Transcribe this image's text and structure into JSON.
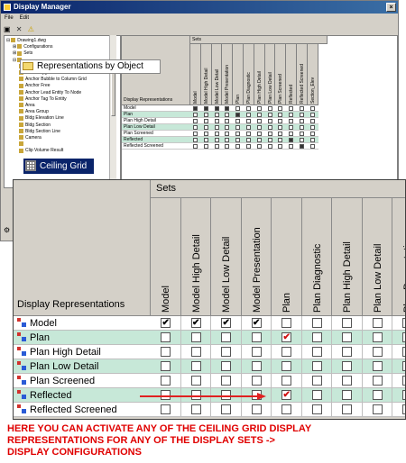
{
  "window": {
    "title": "Display Manager",
    "close_glyph": "×",
    "menu": [
      "File",
      "Edit"
    ],
    "toolbar_icons": [
      "save-icon",
      "delete-icon",
      "warning-icon"
    ],
    "toolbar_glyphs": [
      "▣",
      "✕",
      "⚠"
    ]
  },
  "tree": {
    "items": [
      {
        "label": "Drawing1.dwg",
        "indent": 0,
        "expander": "⊟"
      },
      {
        "label": "Configurations",
        "indent": 1,
        "expander": "⊞"
      },
      {
        "label": "Sets",
        "indent": 1,
        "expander": "⊞"
      },
      {
        "label": "",
        "indent": 1,
        "expander": "⊟"
      },
      {
        "label": "AEC Dimension",
        "indent": 2,
        "expander": ""
      },
      {
        "label": "AEC Polygon",
        "indent": 2,
        "expander": ""
      },
      {
        "label": "Anchor Bubble to Column Grid",
        "indent": 2,
        "expander": ""
      },
      {
        "label": "Anchor Free",
        "indent": 2,
        "expander": ""
      },
      {
        "label": "Anchor Lead Entity To Node",
        "indent": 2,
        "expander": ""
      },
      {
        "label": "Anchor Tag To Entity",
        "indent": 2,
        "expander": ""
      },
      {
        "label": "Area",
        "indent": 2,
        "expander": ""
      },
      {
        "label": "Area Group",
        "indent": 2,
        "expander": ""
      },
      {
        "label": "Bldg Elevation Line",
        "indent": 2,
        "expander": ""
      },
      {
        "label": "Bldg Section",
        "indent": 2,
        "expander": ""
      },
      {
        "label": "Bldg Section Line",
        "indent": 2,
        "expander": ""
      },
      {
        "label": "Camera",
        "indent": 2,
        "expander": ""
      },
      {
        "label": "",
        "indent": 2,
        "expander": ""
      },
      {
        "label": "Clip Volume Result",
        "indent": 2,
        "expander": ""
      }
    ],
    "callout_representations": "Representations by Object",
    "callout_ceiling": "Ceiling Grid"
  },
  "small_grid": {
    "sets_label": "Sets",
    "display_representations_label": "Display Representations",
    "columns": [
      "Model",
      "Model High Detail",
      "Model Low Detail",
      "Model Presentation",
      "Plan",
      "Plan Diagnostic",
      "Plan High Detail",
      "Plan Low Detail",
      "Plan Screened",
      "Reflected",
      "Reflected Screened",
      "Section_Elev"
    ],
    "rows": [
      "Model",
      "Plan",
      "Plan High Detail",
      "Plan Low Detail",
      "Plan Screened",
      "Reflected",
      "Reflected Screened"
    ],
    "checked": [
      [
        true,
        true,
        true,
        true,
        false,
        false,
        false,
        false,
        false,
        false,
        false,
        false
      ],
      [
        false,
        false,
        false,
        false,
        true,
        false,
        false,
        false,
        false,
        false,
        false,
        false
      ],
      [
        false,
        false,
        false,
        false,
        false,
        false,
        false,
        false,
        false,
        false,
        false,
        false
      ],
      [
        false,
        false,
        false,
        false,
        false,
        false,
        false,
        false,
        false,
        false,
        false,
        false
      ],
      [
        false,
        false,
        false,
        false,
        false,
        false,
        false,
        false,
        false,
        false,
        false,
        false
      ],
      [
        false,
        false,
        false,
        false,
        false,
        false,
        false,
        false,
        false,
        true,
        false,
        false
      ],
      [
        false,
        false,
        false,
        false,
        false,
        false,
        false,
        false,
        false,
        false,
        true,
        false
      ]
    ]
  },
  "zoom_grid": {
    "sets_label": "Sets",
    "display_representations_label": "Display Representations",
    "columns": [
      "Model",
      "Model High Detail",
      "Model Low Detail",
      "Model Presentation",
      "Plan",
      "Plan Diagnostic",
      "Plan High Detail",
      "Plan Low Detail",
      "Plan Presentation"
    ],
    "rows": [
      "Model",
      "Plan",
      "Plan High Detail",
      "Plan Low Detail",
      "Plan Screened",
      "Reflected",
      "Reflected Screened"
    ],
    "checked": [
      [
        "black",
        "black",
        "black",
        "black",
        "",
        "",
        "",
        "",
        ""
      ],
      [
        "",
        "",
        "",
        "",
        "red",
        "",
        "",
        "",
        ""
      ],
      [
        "",
        "",
        "",
        "",
        "",
        "",
        "",
        "",
        ""
      ],
      [
        "",
        "",
        "",
        "",
        "",
        "",
        "",
        "",
        ""
      ],
      [
        "",
        "",
        "",
        "",
        "",
        "",
        "",
        "",
        ""
      ],
      [
        "",
        "",
        "",
        "",
        "red",
        "",
        "",
        "",
        ""
      ],
      [
        "",
        "",
        "",
        "",
        "",
        "",
        "",
        "",
        ""
      ]
    ],
    "check_glyph": "✔"
  },
  "caption": {
    "lines": [
      "HERE YOU CAN ACTIVATE ANY OF THE CEILING GRID DISPLAY",
      "REPRESENTATIONS FOR ANY OF THE DISPLAY SETS ->",
      "DISPLAY CONFIGURATIONS"
    ],
    "color": "#e00000"
  },
  "colors": {
    "titlebar": "#0a246a",
    "row_highlight": "#c7e8d8",
    "check_red": "#d01010",
    "arrow": "#e02020"
  }
}
